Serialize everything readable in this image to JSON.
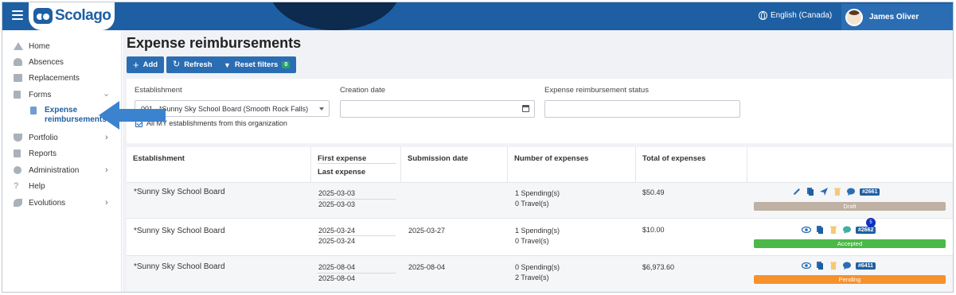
{
  "app": {
    "name": "Scolago"
  },
  "header": {
    "language": "English (Canada)",
    "user_name": "James Oliver"
  },
  "sidebar": {
    "items": [
      {
        "label": "Home"
      },
      {
        "label": "Absences"
      },
      {
        "label": "Replacements"
      },
      {
        "label": "Forms"
      },
      {
        "label": "Expense reimbursements"
      },
      {
        "label": "Portfolio"
      },
      {
        "label": "Reports"
      },
      {
        "label": "Administration"
      },
      {
        "label": "Help"
      },
      {
        "label": "Evolutions"
      }
    ]
  },
  "page": {
    "title": "Expense reimbursements"
  },
  "toolbar": {
    "add_label": "Add",
    "refresh_label": "Refresh",
    "reset_label": "Reset filters",
    "reset_count": "0"
  },
  "filters": {
    "establishment_label": "Establishment",
    "establishment_value": "001 - *Sunny Sky School Board (Smooth Rock Falls)",
    "creation_date_label": "Creation date",
    "creation_date_value": "",
    "status_label": "Expense reimbursement status",
    "status_value": "",
    "all_establishments_label": "All MY establishments from this organization"
  },
  "table": {
    "headers": {
      "establishment": "Establishment",
      "first_expense": "First expense",
      "last_expense": "Last expense",
      "submission": "Submission date",
      "count": "Number of expenses",
      "total": "Total of expenses"
    },
    "rows": [
      {
        "establishment": "*Sunny Sky School Board",
        "first": "2025-03-03",
        "last": "2025-03-03",
        "submission": "",
        "spending": "1 Spending(s)",
        "travel": "0 Travel(s)",
        "total": "$50.49",
        "ref": "#2661",
        "status": "Draft",
        "status_color": "#bfb1a3"
      },
      {
        "establishment": "*Sunny Sky School Board",
        "first": "2025-03-24",
        "last": "2025-03-24",
        "submission": "2025-03-27",
        "spending": "1 Spending(s)",
        "travel": "0 Travel(s)",
        "total": "$10.00",
        "ref": "#2662",
        "status": "Accepted",
        "status_color": "#4cb848",
        "comments": "5"
      },
      {
        "establishment": "*Sunny Sky School Board",
        "first": "2025-08-04",
        "last": "2025-08-04",
        "submission": "2025-08-04",
        "spending": "0 Spending(s)",
        "travel": "2 Travel(s)",
        "total": "$6,973.60",
        "ref": "#6411",
        "status": "Pending",
        "status_color": "#f7922b"
      }
    ]
  }
}
